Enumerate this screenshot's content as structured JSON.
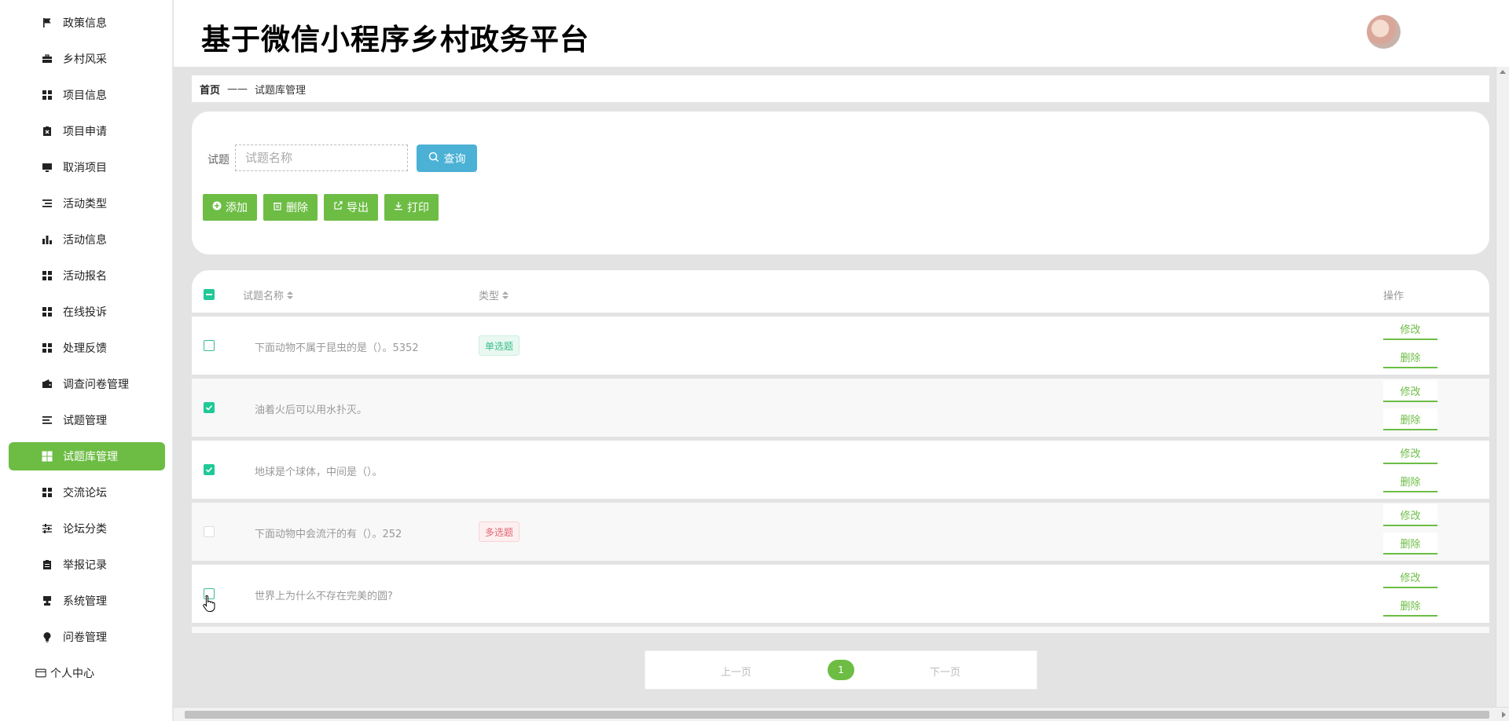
{
  "app": {
    "title": "基于微信小程序乡村政务平台"
  },
  "sidebar": {
    "items": [
      {
        "label": "政策信息",
        "icon": "flag-icon"
      },
      {
        "label": "乡村风采",
        "icon": "briefcase-icon"
      },
      {
        "label": "项目信息",
        "icon": "grid-icon"
      },
      {
        "label": "项目申请",
        "icon": "clipboard-x-icon"
      },
      {
        "label": "取消项目",
        "icon": "monitor-icon"
      },
      {
        "label": "活动类型",
        "icon": "list-icon"
      },
      {
        "label": "活动信息",
        "icon": "bar-chart-icon"
      },
      {
        "label": "活动报名",
        "icon": "grid-icon"
      },
      {
        "label": "在线投诉",
        "icon": "grid-icon"
      },
      {
        "label": "处理反馈",
        "icon": "grid-icon"
      },
      {
        "label": "调查问卷管理",
        "icon": "wallet-icon"
      },
      {
        "label": "试题管理",
        "icon": "list-icon"
      },
      {
        "label": "试题库管理",
        "icon": "grid-icon",
        "active": true
      },
      {
        "label": "交流论坛",
        "icon": "grid-icon"
      },
      {
        "label": "论坛分类",
        "icon": "sliders-icon"
      },
      {
        "label": "举报记录",
        "icon": "clipboard-icon"
      },
      {
        "label": "系统管理",
        "icon": "stamp-icon"
      },
      {
        "label": "问卷管理",
        "icon": "bulb-icon"
      }
    ],
    "personal": {
      "label": "个人中心",
      "icon": "card-icon"
    }
  },
  "breadcrumb": {
    "home": "首页",
    "separator": "——",
    "current": "试题库管理"
  },
  "search": {
    "label": "试题",
    "placeholder": "试题名称",
    "value": "",
    "query_label": "查询"
  },
  "actions": {
    "add": "添加",
    "delete": "删除",
    "export": "导出",
    "print": "打印"
  },
  "table": {
    "columns": {
      "name": "试题名称",
      "type": "类型",
      "operation": "操作"
    },
    "rows": [
      {
        "name": "下面动物不属于昆虫的是（）。5352",
        "type": "单选题",
        "type_kind": "single",
        "checked": false
      },
      {
        "name": "油着火后可以用水扑灭。",
        "type": "",
        "type_kind": "",
        "checked": true
      },
      {
        "name": "地球是个球体，中间是（）。",
        "type": "",
        "type_kind": "",
        "checked": true
      },
      {
        "name": "下面动物中会流汗的有（）。252",
        "type": "多选题",
        "type_kind": "multi",
        "checked": false
      },
      {
        "name": "世界上为什么不存在完美的圆?",
        "type": "",
        "type_kind": "",
        "checked": false
      }
    ],
    "edit_label": "修改",
    "delete_label": "删除"
  },
  "pagination": {
    "prev": "上一页",
    "current": "1",
    "next": "下一页"
  },
  "colors": {
    "accent": "#6dbd45",
    "query": "#4bb1d5",
    "checkbox": "#20c997",
    "multi_tag": "#e16670"
  }
}
